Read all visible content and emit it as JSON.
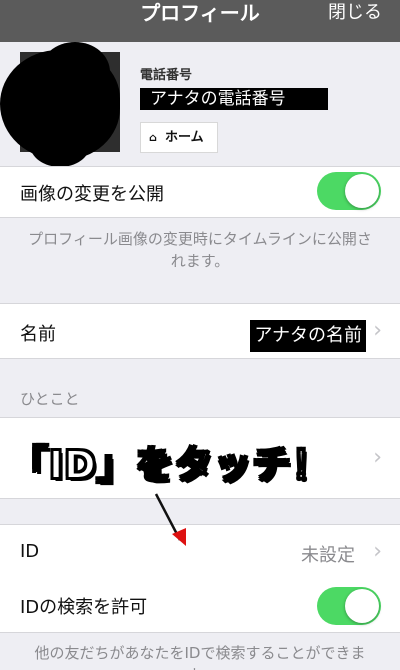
{
  "navbar": {
    "title": "プロフィール",
    "close_label": "閉じる"
  },
  "profile": {
    "phone_label": "電話番号",
    "phone_value": "アナタの電話番号",
    "home_label": "ホーム",
    "home_icon": "home-icon"
  },
  "settings": {
    "publish_image_label": "画像の変更を公開",
    "publish_image_on": true,
    "publish_note": "プロフィール画像の変更時にタイムラインに公開されます。",
    "name_label": "名前",
    "name_value": "アナタの名前",
    "hitokoto_header": "ひとこと",
    "id_label": "ID",
    "id_value": "未設定",
    "id_search_label": "IDの検索を許可",
    "id_search_on": true,
    "id_search_note": "他の友だちがあなたをIDで検索することができます。"
  },
  "annotation": {
    "text": "「ID」をタッチ！"
  },
  "colors": {
    "toggle_on": "#4cd964",
    "navbar": "#5b5b5b",
    "background": "#eeeef3"
  }
}
